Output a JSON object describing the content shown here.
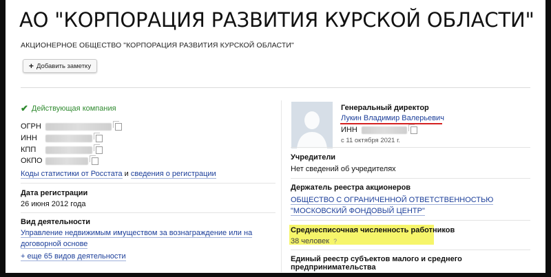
{
  "company": {
    "title": "АО \"КОРПОРАЦИЯ РАЗВИТИЯ КУРСКОЙ ОБЛАСТИ\"",
    "full_name": "АКЦИОНЕРНОЕ ОБЩЕСТВО \"КОРПОРАЦИЯ РАЗВИТИЯ КУРСКОЙ ОБЛАСТИ\"",
    "add_note_label": "Добавить заметку",
    "status": "Действующая компания"
  },
  "identifiers": [
    {
      "label": "ОГРН"
    },
    {
      "label": "ИНН"
    },
    {
      "label": "КПП"
    },
    {
      "label": "ОКПО"
    }
  ],
  "stats": {
    "codes_link": "Коды статистики от Росстата",
    "codes_sep": "и",
    "registration_link": "сведения о регистрации"
  },
  "registration": {
    "heading": "Дата регистрации",
    "value": "26 июня 2012 года"
  },
  "activity": {
    "heading": "Вид деятельности",
    "main_link": "Управление недвижимым имуществом за вознаграждение или на договорной основе",
    "more_link": "+ еще 65 видов деятельности"
  },
  "director": {
    "heading": "Генеральный директор",
    "name": "Лукин Владимир Валерьевич",
    "inn_label": "ИНН",
    "since": "с 11 октября 2021 г."
  },
  "founders": {
    "heading": "Учредители",
    "value": "Нет сведений об учредителях"
  },
  "registry_holder": {
    "heading": "Держатель реестра акционеров",
    "value": "ОБЩЕСТВО С ОГРАНИЧЕННОЙ ОТВЕТСТВЕННОСТЬЮ \"МОСКОВСКИЙ ФОНДОВЫЙ ЦЕНТР\""
  },
  "employees": {
    "heading": "Среднесписочная численность работников",
    "value": "38 человек",
    "help": "?"
  },
  "msp": {
    "heading": "Единый реестр субъектов малого и среднего предпринимательства"
  }
}
